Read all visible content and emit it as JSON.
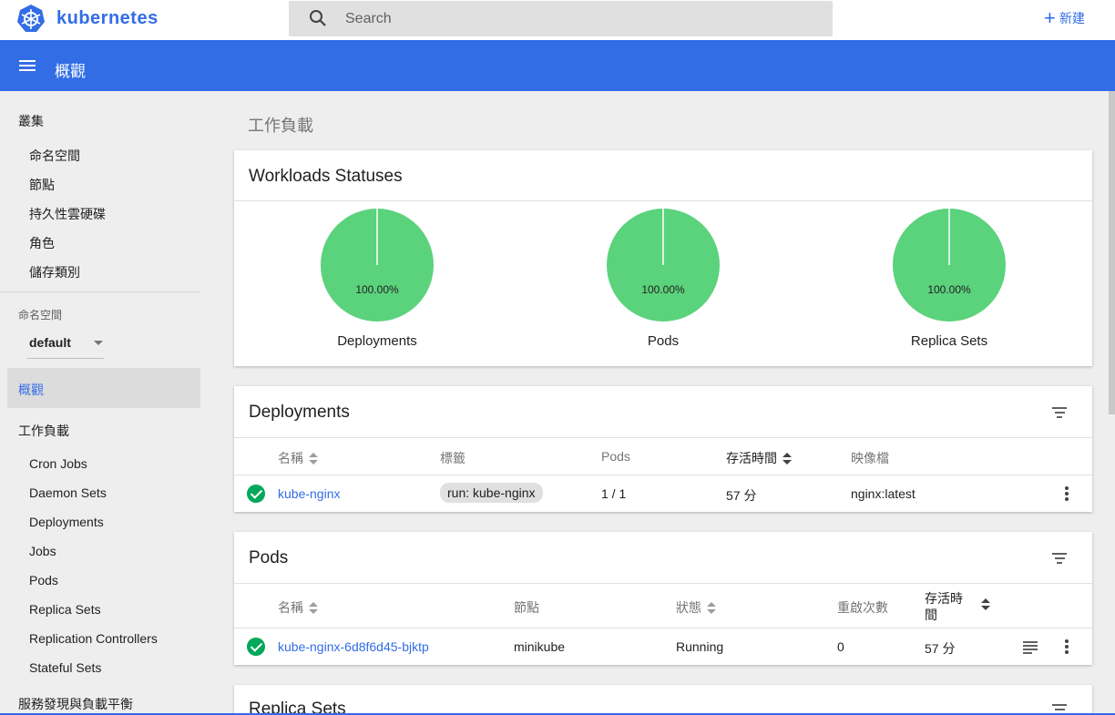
{
  "app": {
    "brand": "kubernetes",
    "create_label": "新建"
  },
  "search": {
    "placeholder": "Search"
  },
  "toolbar": {
    "title": "概觀"
  },
  "sidebar": {
    "cluster_header": "叢集",
    "cluster_items": [
      "命名空間",
      "節點",
      "持久性雲硬碟",
      "角色",
      "儲存類別"
    ],
    "namespace_label": "命名空間",
    "namespace_value": "default",
    "overview": "概觀",
    "workloads_header": "工作負載",
    "workload_items": [
      "Cron Jobs",
      "Daemon Sets",
      "Deployments",
      "Jobs",
      "Pods",
      "Replica Sets",
      "Replication Controllers",
      "Stateful Sets"
    ],
    "discovery_header": "服務發現與負載平衡"
  },
  "main": {
    "section_title": "工作負載",
    "status_card": {
      "title": "Workloads Statuses",
      "charts": [
        {
          "label": "Deployments",
          "percent_text": "100.00%",
          "value": 1.0,
          "color": "#5bd27c"
        },
        {
          "label": "Pods",
          "percent_text": "100.00%",
          "value": 1.0,
          "color": "#5bd27c"
        },
        {
          "label": "Replica Sets",
          "percent_text": "100.00%",
          "value": 1.0,
          "color": "#5bd27c"
        }
      ]
    },
    "deployments": {
      "title": "Deployments",
      "headers": {
        "name": "名稱",
        "labels": "標籤",
        "pods": "Pods",
        "age": "存活時間",
        "images": "映像檔"
      },
      "rows": [
        {
          "name": "kube-nginx",
          "label": "run: kube-nginx",
          "pods": "1 / 1",
          "age": "57 分",
          "image": "nginx:latest"
        }
      ]
    },
    "pods": {
      "title": "Pods",
      "headers": {
        "name": "名稱",
        "node": "節點",
        "status": "狀態",
        "restarts": "重啟次數",
        "age": "存活時間"
      },
      "rows": [
        {
          "name": "kube-nginx-6d8f6d45-bjktp",
          "node": "minikube",
          "status": "Running",
          "restarts": "0",
          "age": "57 分"
        }
      ]
    },
    "replica_sets": {
      "title": "Replica Sets"
    }
  },
  "colors": {
    "accent": "#326de6",
    "success": "#00a85a",
    "pie": "#5bd27c"
  }
}
